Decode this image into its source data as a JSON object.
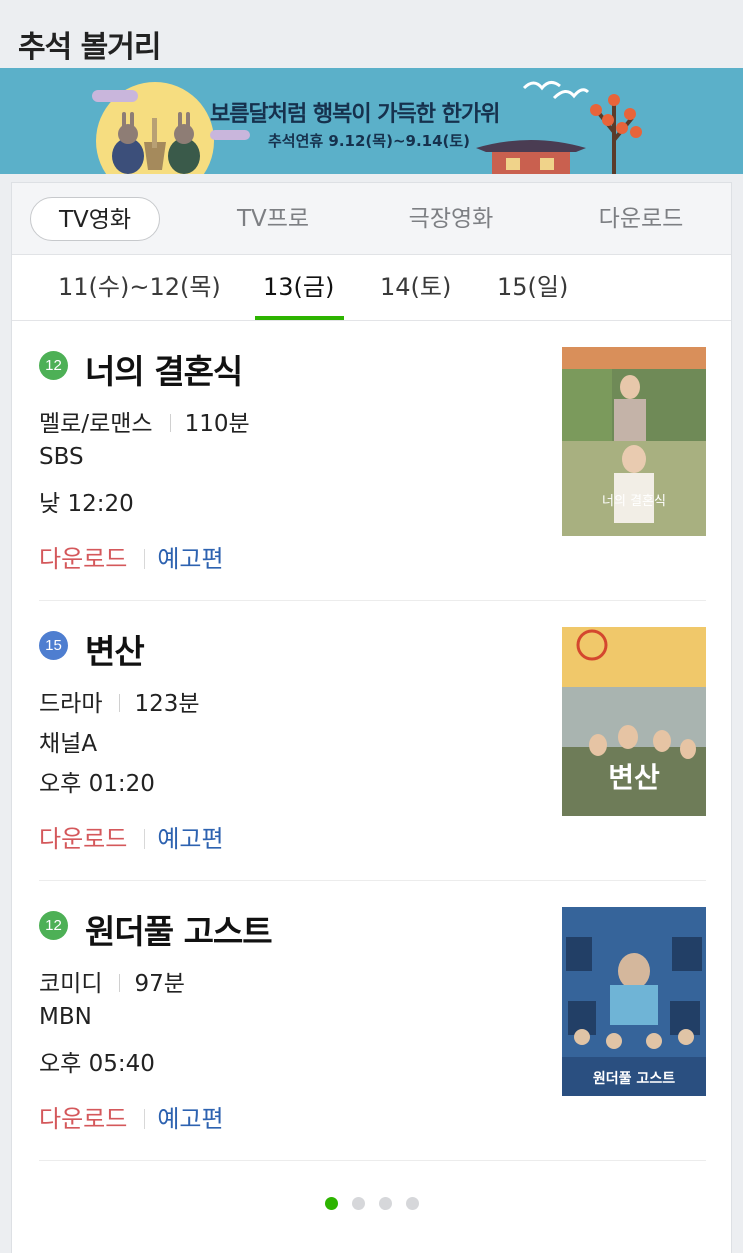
{
  "header": {
    "title": "추석 볼거리"
  },
  "banner": {
    "title": "보름달처럼 행복이 가득한 한가위",
    "subtitle": "추석연휴 9.12(목)~9.14(토)"
  },
  "category_tabs": [
    {
      "label": "TV영화",
      "active": true
    },
    {
      "label": "TV프로",
      "active": false
    },
    {
      "label": "극장영화",
      "active": false
    },
    {
      "label": "다운로드",
      "active": false
    }
  ],
  "day_tabs": [
    {
      "label": "11(수)~12(목)",
      "active": false
    },
    {
      "label": "13(금)",
      "active": true
    },
    {
      "label": "14(토)",
      "active": false
    },
    {
      "label": "15(일)",
      "active": false
    }
  ],
  "movies": [
    {
      "rating": "12",
      "title": "너의 결혼식",
      "genre": "멜로/로맨스",
      "runtime": "110분",
      "channel": "SBS",
      "time": "낮 12:20",
      "download_label": "다운로드",
      "trailer_label": "예고편",
      "poster_text": "너의 결혼식"
    },
    {
      "rating": "15",
      "title": "변산",
      "genre": "드라마",
      "runtime": "123분",
      "channel": "채널A",
      "time": "오후 01:20",
      "download_label": "다운로드",
      "trailer_label": "예고편",
      "poster_text": "변산"
    },
    {
      "rating": "12",
      "title": "원더풀 고스트",
      "genre": "코미디",
      "runtime": "97분",
      "channel": "MBN",
      "time": "오후 05:40",
      "download_label": "다운로드",
      "trailer_label": "예고편",
      "poster_text": "원더풀 고스트"
    }
  ],
  "pager": {
    "pages": 4,
    "current": 1
  },
  "colors": {
    "accent_green": "#2db400",
    "download_red": "#d4585b",
    "trailer_blue": "#2d62b0",
    "rating_12": "#4db056",
    "rating_15": "#4e7ed0",
    "banner_bg": "#5bb0c9"
  }
}
